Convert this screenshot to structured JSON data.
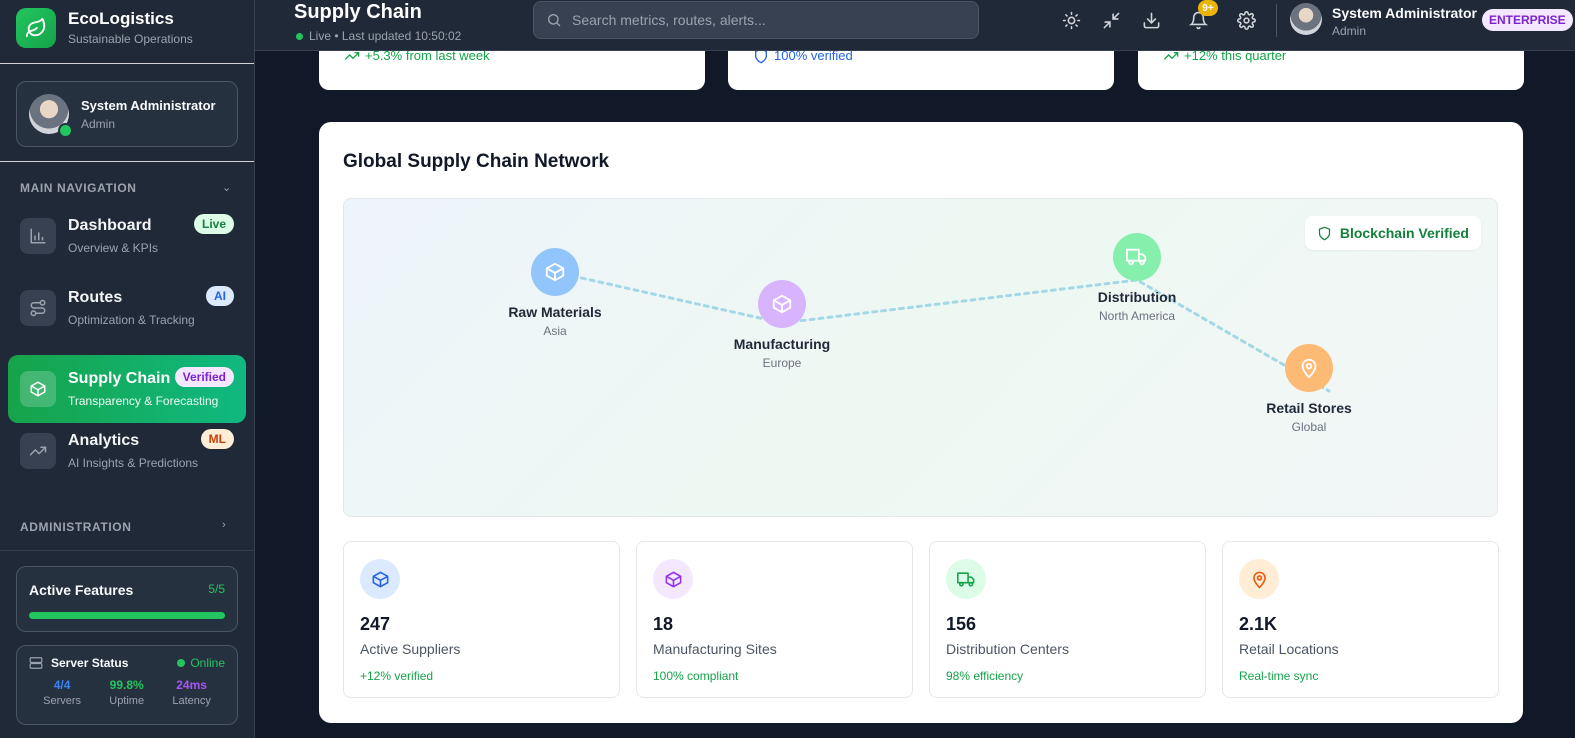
{
  "brand": {
    "name": "EcoLogistics",
    "tagline": "Sustainable Operations"
  },
  "user_card": {
    "name": "System Administrator",
    "role": "Admin"
  },
  "sidebar": {
    "main_nav_label": "MAIN NAVIGATION",
    "admin_label": "ADMINISTRATION",
    "items": [
      {
        "title": "Dashboard",
        "subtitle": "Overview & KPIs",
        "badge": "Live"
      },
      {
        "title": "Routes",
        "subtitle": "Optimization & Tracking",
        "badge": "AI"
      },
      {
        "title": "Supply Chain",
        "subtitle": "Transparency & Forecasting",
        "badge": "Verified"
      },
      {
        "title": "Analytics",
        "subtitle": "AI Insights & Predictions",
        "badge": "ML"
      }
    ],
    "features": {
      "title": "Active Features",
      "count": "5/5",
      "progress": 1.0
    },
    "server": {
      "title": "Server Status",
      "status": "Online",
      "stats": [
        {
          "value": "4/4",
          "label": "Servers",
          "color": "#3b82f6"
        },
        {
          "value": "99.8%",
          "label": "Uptime",
          "color": "#22c55e"
        },
        {
          "value": "24ms",
          "label": "Latency",
          "color": "#a855f7"
        }
      ]
    }
  },
  "header": {
    "title": "Supply Chain",
    "status": "Live • Last updated 10:50:02",
    "search_placeholder": "Search metrics, routes, alerts...",
    "notification_count": "9+",
    "user_name": "System Administrator",
    "user_role": "Admin",
    "plan_badge": "ENTERPRISE",
    "icons": [
      "sun-icon",
      "minimize-icon",
      "download-icon",
      "bell-icon",
      "settings-icon"
    ]
  },
  "top_cards": [
    {
      "note": "+5.3% from last week",
      "icon": "trending-up-icon",
      "color": "#16a34a"
    },
    {
      "note": "100% verified",
      "icon": "shield-icon",
      "color": "#2563eb"
    },
    {
      "note": "+12% this quarter",
      "icon": "trending-up-icon",
      "color": "#16a34a"
    }
  ],
  "network": {
    "title": "Global Supply Chain Network",
    "verified_badge": "Blockchain Verified",
    "nodes": [
      {
        "title": "Raw Materials",
        "region": "Asia",
        "icon": "box-icon",
        "color": "#93c5fd"
      },
      {
        "title": "Manufacturing",
        "region": "Europe",
        "icon": "box-icon",
        "color": "#d8b4fe"
      },
      {
        "title": "Distribution",
        "region": "North America",
        "icon": "truck-icon",
        "color": "#86efac"
      },
      {
        "title": "Retail Stores",
        "region": "Global",
        "icon": "map-pin-icon",
        "color": "#fdba74"
      }
    ],
    "stats": [
      {
        "value": "247",
        "label": "Active Suppliers",
        "note": "+12% verified",
        "icon": "box-icon",
        "icon_color": "#2563eb",
        "bg": "#dbeafe"
      },
      {
        "value": "18",
        "label": "Manufacturing Sites",
        "note": "100% compliant",
        "icon": "box-icon",
        "icon_color": "#9333ea",
        "bg": "#f3e8ff"
      },
      {
        "value": "156",
        "label": "Distribution Centers",
        "note": "98% efficiency",
        "icon": "truck-icon",
        "icon_color": "#16a34a",
        "bg": "#dcfce7"
      },
      {
        "value": "2.1K",
        "label": "Retail Locations",
        "note": "Real-time sync",
        "icon": "map-pin-icon",
        "icon_color": "#ea580c",
        "bg": "#ffedd5"
      }
    ]
  }
}
